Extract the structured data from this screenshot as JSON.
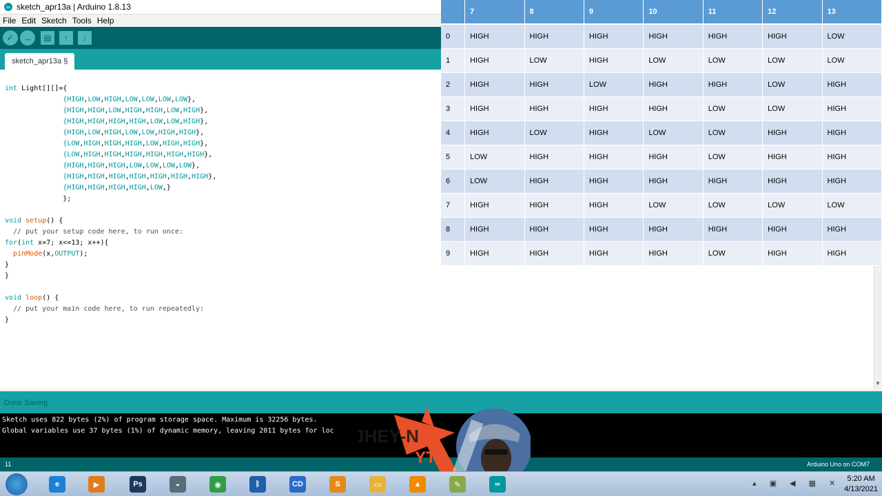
{
  "window": {
    "title": "sketch_apr13a | Arduino 1.8.13"
  },
  "menu": [
    "File",
    "Edit",
    "Sketch",
    "Tools",
    "Help"
  ],
  "toolbar": {
    "verify": "✓",
    "upload": "→",
    "new": "▤",
    "open": "↑",
    "save": "↓"
  },
  "tab": {
    "label": "sketch_apr13a §"
  },
  "code_lines": [
    "int Light[][]={",
    "              {HIGH,LOW,HIGH,LOW,LOW,LOW,LOW},",
    "              {HIGH,HIGH,LOW,HIGH,HIGH,LOW,HIGH},",
    "              {HIGH,HIGH,HIGH,HIGH,LOW,LOW,HIGH},",
    "              {HIGH,LOW,HIGH,LOW,LOW,HIGH,HIGH},",
    "              {LOW,HIGH,HIGH,HIGH,LOW,HIGH,HIGH},",
    "              {LOW,HIGH,HIGH,HIGH,HIGH,HIGH,HIGH},",
    "              {HIGH,HIGH,HIGH,LOW,LOW,LOW,LOW},",
    "              {HIGH,HIGH,HIGH,HIGH,HIGH,HIGH,HIGH},",
    "              {HIGH,HIGH,HIGH,HIGH,LOW,}",
    "              };",
    "",
    "void setup() {",
    "  // put your setup code here, to run once:",
    "for(int x=7; x<=13; x++){",
    "  pinMode(x,OUTPUT);",
    "}",
    "}",
    "",
    "void loop() {",
    "  // put your main code here, to run repeatedly:",
    "}"
  ],
  "status": {
    "message": "Done Saving."
  },
  "console": [
    "Sketch uses 822 bytes (2%) of program storage space. Maximum is 32256 bytes.",
    "Global variables use 37 bytes (1%) of dynamic memory, leaving 2011 bytes for loc"
  ],
  "footer": {
    "line_number": "11",
    "board": "Arduino Uno on COM7"
  },
  "table": {
    "headers": [
      "",
      "7",
      "8",
      "9",
      "10",
      "11",
      "12",
      "13"
    ],
    "rows": [
      [
        "0",
        "HIGH",
        "HIGH",
        "HIGH",
        "HIGH",
        "HIGH",
        "HIGH",
        "LOW"
      ],
      [
        "1",
        "HIGH",
        "LOW",
        "HIGH",
        "LOW",
        "LOW",
        "LOW",
        "LOW"
      ],
      [
        "2",
        "HIGH",
        "HIGH",
        "LOW",
        "HIGH",
        "HIGH",
        "LOW",
        "HIGH"
      ],
      [
        "3",
        "HIGH",
        "HIGH",
        "HIGH",
        "HIGH",
        "LOW",
        "LOW",
        "HIGH"
      ],
      [
        "4",
        "HIGH",
        "LOW",
        "HIGH",
        "LOW",
        "LOW",
        "HIGH",
        "HIGH"
      ],
      [
        "5",
        "LOW",
        "HIGH",
        "HIGH",
        "HIGH",
        "LOW",
        "HIGH",
        "HIGH"
      ],
      [
        "6",
        "LOW",
        "HIGH",
        "HIGH",
        "HIGH",
        "HIGH",
        "HIGH",
        "HIGH"
      ],
      [
        "7",
        "HIGH",
        "HIGH",
        "HIGH",
        "LOW",
        "LOW",
        "LOW",
        "LOW"
      ],
      [
        "8",
        "HIGH",
        "HIGH",
        "HIGH",
        "HIGH",
        "HIGH",
        "HIGH",
        "HIGH"
      ],
      [
        "9",
        "HIGH",
        "HIGH",
        "HIGH",
        "HIGH",
        "LOW",
        "HIGH",
        "HIGH"
      ]
    ]
  },
  "watermark": {
    "text": "JHEY-N",
    "sub": "YT"
  },
  "taskbar": {
    "apps": [
      {
        "name": "internet-explorer",
        "glyph": "e",
        "color": "#1e7fd6"
      },
      {
        "name": "media-player",
        "glyph": "▶",
        "color": "#e07b1e"
      },
      {
        "name": "photoshop",
        "glyph": "Ps",
        "color": "#1b3a5a"
      },
      {
        "name": "helmet-app",
        "glyph": "◒",
        "color": "#5a6b7b"
      },
      {
        "name": "chrome",
        "glyph": "◉",
        "color": "#2f9e44"
      },
      {
        "name": "bluetooth",
        "glyph": "ᛒ",
        "color": "#1f5fa8"
      },
      {
        "name": "cd-app",
        "glyph": "CD",
        "color": "#2a6ac8"
      },
      {
        "name": "sublime",
        "glyph": "S",
        "color": "#e48a1a"
      },
      {
        "name": "explorer",
        "glyph": "▭",
        "color": "#e6b43a"
      },
      {
        "name": "vlc",
        "glyph": "▲",
        "color": "#f08a00"
      },
      {
        "name": "paint",
        "glyph": "✎",
        "color": "#8aa84a"
      },
      {
        "name": "arduino",
        "glyph": "∞",
        "color": "#00979d"
      }
    ],
    "time": "5:20 AM",
    "date": "4/13/2021"
  }
}
